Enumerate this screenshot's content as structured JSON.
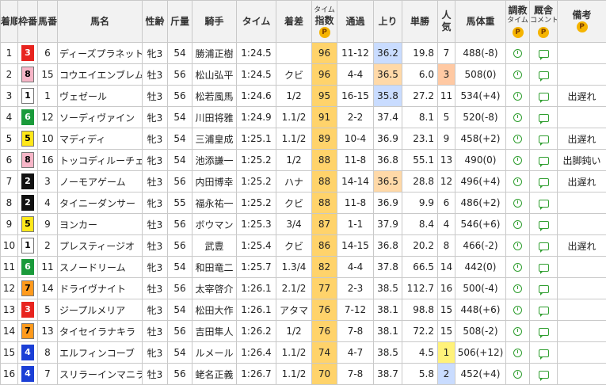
{
  "headers": {
    "rank": "着順",
    "waku": "枠番",
    "umaban": "馬番",
    "name": "馬名",
    "sex_age": "性齢",
    "weight": "斤量",
    "jockey": "騎手",
    "time": "タイム",
    "margin": "着差",
    "index_top": "タイム",
    "index_bottom": "指数",
    "passing": "通過",
    "agari": "上り",
    "odds": "単勝",
    "pop": "人気",
    "body_weight": "馬体重",
    "training_top": "調教",
    "training_bottom": "タイム",
    "comment_top": "厩舎",
    "comment_bottom": "コメント",
    "remarks": "備考",
    "premium_icon": "P"
  },
  "rows": [
    {
      "rank": "1",
      "waku": "3",
      "umaban": "6",
      "name": "ディーズプラネット",
      "sex_age": "牝3",
      "weight": "54",
      "jockey": "勝浦正樹",
      "time": "1:24.5",
      "margin": "",
      "index": "96",
      "passing": "11-12",
      "agari": "36.2",
      "odds": "19.8",
      "pop": "7",
      "body_weight": "488(-8)",
      "remarks": ""
    },
    {
      "rank": "2",
      "waku": "8",
      "umaban": "15",
      "name": "コウエイエンブレム",
      "sex_age": "牡3",
      "weight": "56",
      "jockey": "松山弘平",
      "time": "1:24.5",
      "margin": "クビ",
      "index": "96",
      "passing": "4-4",
      "agari": "36.5",
      "odds": "6.0",
      "pop": "3",
      "body_weight": "508(0)",
      "remarks": ""
    },
    {
      "rank": "3",
      "waku": "1",
      "umaban": "1",
      "name": "ヴェゼール",
      "sex_age": "牡3",
      "weight": "56",
      "jockey": "松若風馬",
      "time": "1:24.6",
      "margin": "1/2",
      "index": "95",
      "passing": "16-15",
      "agari": "35.8",
      "odds": "27.2",
      "pop": "11",
      "body_weight": "534(+4)",
      "remarks": "出遅れ"
    },
    {
      "rank": "4",
      "waku": "6",
      "umaban": "12",
      "name": "ソーディヴァイン",
      "sex_age": "牝3",
      "weight": "54",
      "jockey": "川田将雅",
      "time": "1:24.9",
      "margin": "1.1/2",
      "index": "91",
      "passing": "2-2",
      "agari": "37.4",
      "odds": "8.1",
      "pop": "5",
      "body_weight": "520(-8)",
      "remarks": ""
    },
    {
      "rank": "5",
      "waku": "5",
      "umaban": "10",
      "name": "マディディ",
      "sex_age": "牝3",
      "weight": "54",
      "jockey": "三浦皇成",
      "time": "1:25.1",
      "margin": "1.1/2",
      "index": "89",
      "passing": "10-4",
      "agari": "36.9",
      "odds": "23.1",
      "pop": "9",
      "body_weight": "458(+2)",
      "remarks": "出遅れ"
    },
    {
      "rank": "6",
      "waku": "8",
      "umaban": "16",
      "name": "トッコディルーチェ",
      "sex_age": "牝3",
      "weight": "54",
      "jockey": "池添謙一",
      "time": "1:25.2",
      "margin": "1/2",
      "index": "88",
      "passing": "11-8",
      "agari": "36.8",
      "odds": "55.1",
      "pop": "13",
      "body_weight": "490(0)",
      "remarks": "出脚鈍い"
    },
    {
      "rank": "7",
      "waku": "2",
      "umaban": "3",
      "name": "ノーモアゲーム",
      "sex_age": "牡3",
      "weight": "56",
      "jockey": "内田博幸",
      "time": "1:25.2",
      "margin": "ハナ",
      "index": "88",
      "passing": "14-14",
      "agari": "36.5",
      "odds": "28.8",
      "pop": "12",
      "body_weight": "496(+4)",
      "remarks": "出遅れ"
    },
    {
      "rank": "8",
      "waku": "2",
      "umaban": "4",
      "name": "タイニーダンサー",
      "sex_age": "牝3",
      "weight": "55",
      "jockey": "福永祐一",
      "time": "1:25.2",
      "margin": "クビ",
      "index": "88",
      "passing": "11-8",
      "agari": "36.9",
      "odds": "9.9",
      "pop": "6",
      "body_weight": "486(+2)",
      "remarks": ""
    },
    {
      "rank": "9",
      "waku": "5",
      "umaban": "9",
      "name": "ヨンカー",
      "sex_age": "牡3",
      "weight": "56",
      "jockey": "ボウマン",
      "time": "1:25.3",
      "margin": "3/4",
      "index": "87",
      "passing": "1-1",
      "agari": "37.9",
      "odds": "8.4",
      "pop": "4",
      "body_weight": "546(+6)",
      "remarks": ""
    },
    {
      "rank": "10",
      "waku": "1",
      "umaban": "2",
      "name": "プレスティージオ",
      "sex_age": "牡3",
      "weight": "56",
      "jockey": "武豊",
      "time": "1:25.4",
      "margin": "クビ",
      "index": "86",
      "passing": "14-15",
      "agari": "36.8",
      "odds": "20.2",
      "pop": "8",
      "body_weight": "466(-2)",
      "remarks": "出遅れ"
    },
    {
      "rank": "11",
      "waku": "6",
      "umaban": "11",
      "name": "スノードリーム",
      "sex_age": "牝3",
      "weight": "54",
      "jockey": "和田竜二",
      "time": "1:25.7",
      "margin": "1.3/4",
      "index": "82",
      "passing": "4-4",
      "agari": "37.8",
      "odds": "66.5",
      "pop": "14",
      "body_weight": "442(0)",
      "remarks": ""
    },
    {
      "rank": "12",
      "waku": "7",
      "umaban": "14",
      "name": "ドライヴナイト",
      "sex_age": "牡3",
      "weight": "56",
      "jockey": "太宰啓介",
      "time": "1:26.1",
      "margin": "2.1/2",
      "index": "77",
      "passing": "2-3",
      "agari": "38.5",
      "odds": "112.7",
      "pop": "16",
      "body_weight": "500(-4)",
      "remarks": ""
    },
    {
      "rank": "13",
      "waku": "3",
      "umaban": "5",
      "name": "ジープルメリア",
      "sex_age": "牝3",
      "weight": "54",
      "jockey": "松田大作",
      "time": "1:26.1",
      "margin": "アタマ",
      "index": "76",
      "passing": "7-12",
      "agari": "38.1",
      "odds": "98.8",
      "pop": "15",
      "body_weight": "448(+6)",
      "remarks": ""
    },
    {
      "rank": "14",
      "waku": "7",
      "umaban": "13",
      "name": "タイセイラナキラ",
      "sex_age": "牡3",
      "weight": "56",
      "jockey": "吉田隼人",
      "time": "1:26.2",
      "margin": "1/2",
      "index": "76",
      "passing": "7-8",
      "agari": "38.1",
      "odds": "72.2",
      "pop": "15",
      "body_weight": "508(-2)",
      "remarks": ""
    },
    {
      "rank": "15",
      "waku": "4",
      "umaban": "8",
      "name": "エルフィンコーブ",
      "sex_age": "牝3",
      "weight": "54",
      "jockey": "ルメール",
      "time": "1:26.4",
      "margin": "1.1/2",
      "index": "74",
      "passing": "4-7",
      "agari": "38.5",
      "odds": "4.5",
      "pop": "1",
      "body_weight": "506(+12)",
      "remarks": ""
    },
    {
      "rank": "16",
      "waku": "4",
      "umaban": "7",
      "name": "スリラーインマニラ",
      "sex_age": "牡3",
      "weight": "56",
      "jockey": "蛯名正義",
      "time": "1:26.7",
      "margin": "1.1/2",
      "index": "70",
      "passing": "7-8",
      "agari": "38.7",
      "odds": "5.8",
      "pop": "2",
      "body_weight": "452(+4)",
      "remarks": ""
    }
  ]
}
